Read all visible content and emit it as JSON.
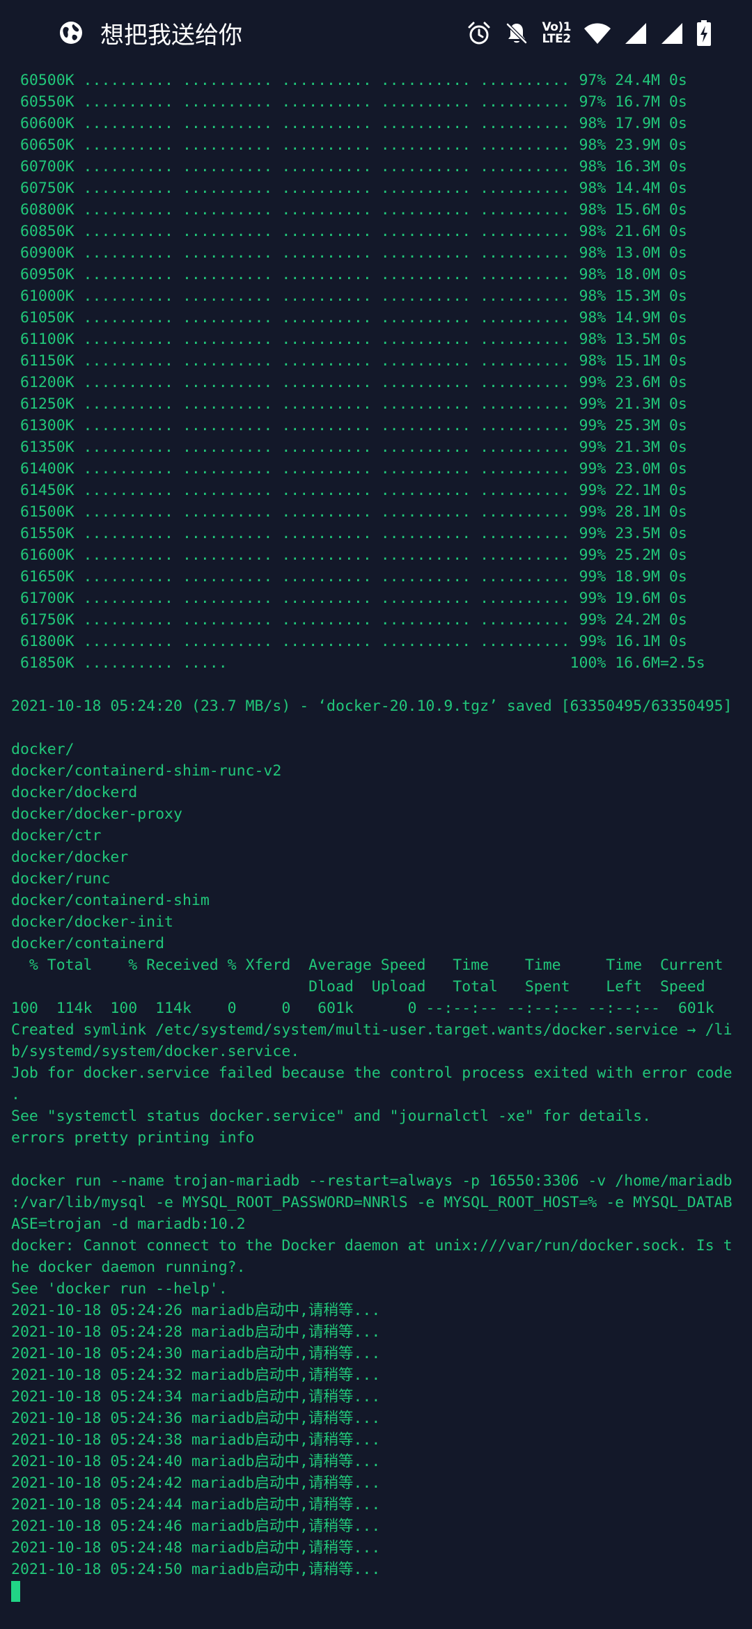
{
  "status_bar": {
    "app_title": "想把我送给你",
    "volte_top": "Vo)1",
    "volte_bottom": "LTE2",
    "icons": [
      "globe-icon",
      "alarm-icon",
      "bell-off-icon",
      "volte-icon",
      "wifi-icon",
      "signal-icon",
      "signal-icon",
      "battery-charging-icon"
    ]
  },
  "colors": {
    "background": "#131829",
    "terminal_text": "#21c77a",
    "cursor": "#21d486"
  },
  "terminal": {
    "lines": [
      " 60500K .......... .......... .......... .......... .......... 97% 24.4M 0s",
      " 60550K .......... .......... .......... .......... .......... 97% 16.7M 0s",
      " 60600K .......... .......... .......... .......... .......... 98% 17.9M 0s",
      " 60650K .......... .......... .......... .......... .......... 98% 23.9M 0s",
      " 60700K .......... .......... .......... .......... .......... 98% 16.3M 0s",
      " 60750K .......... .......... .......... .......... .......... 98% 14.4M 0s",
      " 60800K .......... .......... .......... .......... .......... 98% 15.6M 0s",
      " 60850K .......... .......... .......... .......... .......... 98% 21.6M 0s",
      " 60900K .......... .......... .......... .......... .......... 98% 13.0M 0s",
      " 60950K .......... .......... .......... .......... .......... 98% 18.0M 0s",
      " 61000K .......... .......... .......... .......... .......... 98% 15.3M 0s",
      " 61050K .......... .......... .......... .......... .......... 98% 14.9M 0s",
      " 61100K .......... .......... .......... .......... .......... 98% 13.5M 0s",
      " 61150K .......... .......... .......... .......... .......... 98% 15.1M 0s",
      " 61200K .......... .......... .......... .......... .......... 99% 23.6M 0s",
      " 61250K .......... .......... .......... .......... .......... 99% 21.3M 0s",
      " 61300K .......... .......... .......... .......... .......... 99% 25.3M 0s",
      " 61350K .......... .......... .......... .......... .......... 99% 21.3M 0s",
      " 61400K .......... .......... .......... .......... .......... 99% 23.0M 0s",
      " 61450K .......... .......... .......... .......... .......... 99% 22.1M 0s",
      " 61500K .......... .......... .......... .......... .......... 99% 28.1M 0s",
      " 61550K .......... .......... .......... .......... .......... 99% 23.5M 0s",
      " 61600K .......... .......... .......... .......... .......... 99% 25.2M 0s",
      " 61650K .......... .......... .......... .......... .......... 99% 18.9M 0s",
      " 61700K .......... .......... .......... .......... .......... 99% 19.6M 0s",
      " 61750K .......... .......... .......... .......... .......... 99% 24.2M 0s",
      " 61800K .......... .......... .......... .......... .......... 99% 16.1M 0s",
      " 61850K .......... .....                                      100% 16.6M=2.5s",
      "",
      "2021-10-18 05:24:20 (23.7 MB/s) - ‘docker-20.10.9.tgz’ saved [63350495/63350495]",
      "",
      "docker/",
      "docker/containerd-shim-runc-v2",
      "docker/dockerd",
      "docker/docker-proxy",
      "docker/ctr",
      "docker/docker",
      "docker/runc",
      "docker/containerd-shim",
      "docker/docker-init",
      "docker/containerd",
      "  % Total    % Received % Xferd  Average Speed   Time    Time     Time  Current",
      "                                 Dload  Upload   Total   Spent    Left  Speed",
      "100  114k  100  114k    0     0   601k      0 --:--:-- --:--:-- --:--:--  601k",
      "Created symlink /etc/systemd/system/multi-user.target.wants/docker.service → /li",
      "b/systemd/system/docker.service.",
      "Job for docker.service failed because the control process exited with error code",
      ".",
      "See \"systemctl status docker.service\" and \"journalctl -xe\" for details.",
      "errors pretty printing info",
      "",
      "docker run --name trojan-mariadb --restart=always -p 16550:3306 -v /home/mariadb",
      ":/var/lib/mysql -e MYSQL_ROOT_PASSWORD=NNRlS -e MYSQL_ROOT_HOST=% -e MYSQL_DATAB",
      "ASE=trojan -d mariadb:10.2",
      "docker: Cannot connect to the Docker daemon at unix:///var/run/docker.sock. Is t",
      "he docker daemon running?.",
      "See 'docker run --help'.",
      "2021-10-18 05:24:26 mariadb启动中,请稍等...",
      "2021-10-18 05:24:28 mariadb启动中,请稍等...",
      "2021-10-18 05:24:30 mariadb启动中,请稍等...",
      "2021-10-18 05:24:32 mariadb启动中,请稍等...",
      "2021-10-18 05:24:34 mariadb启动中,请稍等...",
      "2021-10-18 05:24:36 mariadb启动中,请稍等...",
      "2021-10-18 05:24:38 mariadb启动中,请稍等...",
      "2021-10-18 05:24:40 mariadb启动中,请稍等...",
      "2021-10-18 05:24:42 mariadb启动中,请稍等...",
      "2021-10-18 05:24:44 mariadb启动中,请稍等...",
      "2021-10-18 05:24:46 mariadb启动中,请稍等...",
      "2021-10-18 05:24:48 mariadb启动中,请稍等...",
      "2021-10-18 05:24:50 mariadb启动中,请稍等..."
    ]
  }
}
